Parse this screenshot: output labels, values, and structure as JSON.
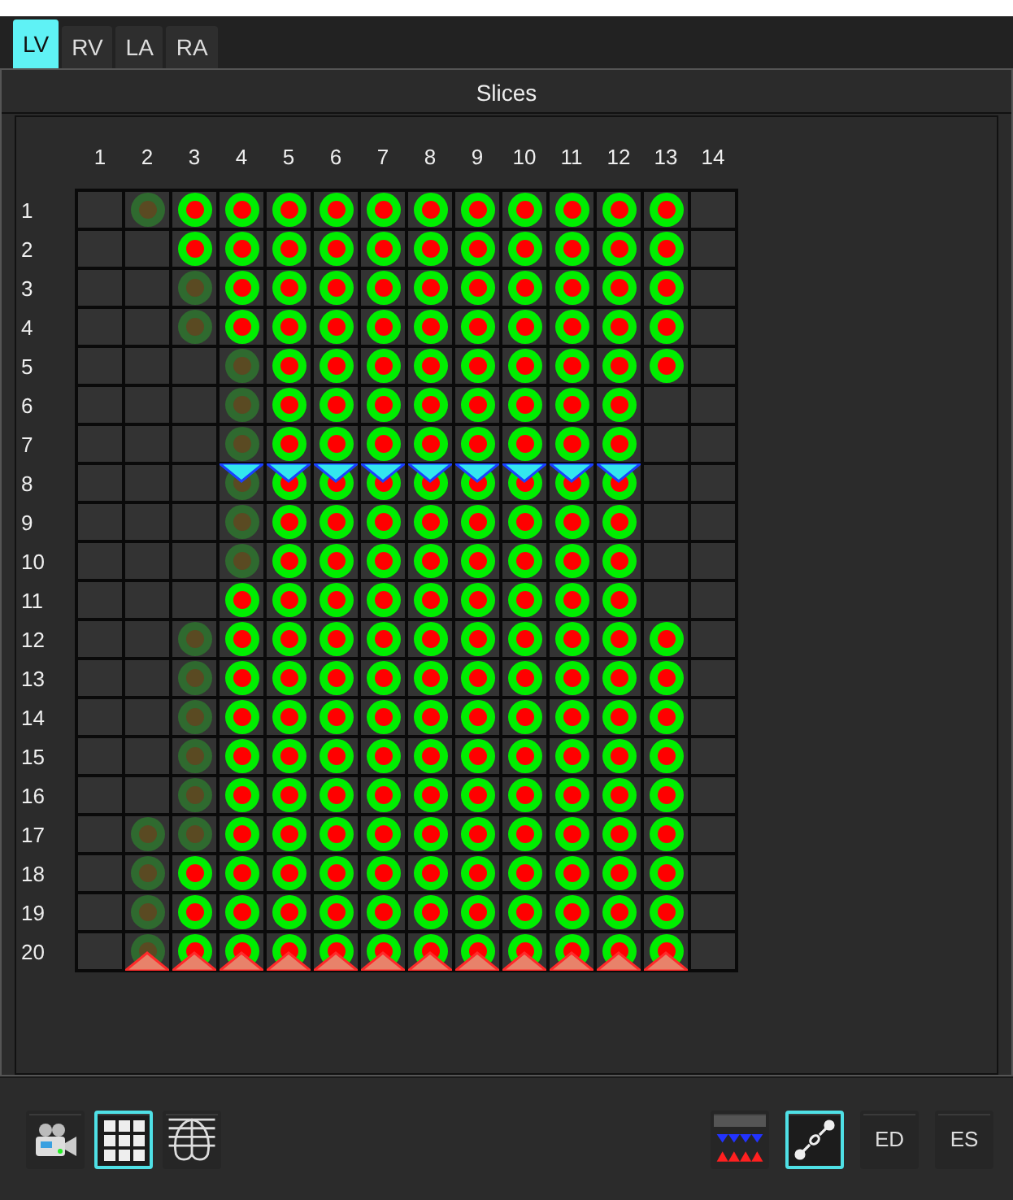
{
  "tabs": [
    {
      "label": "LV",
      "selected": true
    },
    {
      "label": "RV",
      "selected": false
    },
    {
      "label": "LA",
      "selected": false
    },
    {
      "label": "RA",
      "selected": false
    }
  ],
  "matrix": {
    "title": "Slices",
    "columns": [
      "1",
      "2",
      "3",
      "4",
      "5",
      "6",
      "7",
      "8",
      "9",
      "10",
      "11",
      "12",
      "13",
      "14"
    ],
    "rows": [
      {
        "label": "1",
        "ed_marker": false,
        "es_marker": false,
        "cells": [
          {
            "dot": false
          },
          {
            "dot": true,
            "dimmed": true
          },
          {
            "dot": true,
            "dimmed": false
          },
          {
            "dot": true,
            "dimmed": false
          },
          {
            "dot": true,
            "dimmed": false
          },
          {
            "dot": true,
            "dimmed": false
          },
          {
            "dot": true,
            "dimmed": false
          },
          {
            "dot": true,
            "dimmed": false
          },
          {
            "dot": true,
            "dimmed": false
          },
          {
            "dot": true,
            "dimmed": false
          },
          {
            "dot": true,
            "dimmed": false
          },
          {
            "dot": true,
            "dimmed": false
          },
          {
            "dot": true,
            "dimmed": false
          },
          {
            "dot": false
          }
        ]
      },
      {
        "label": "2",
        "ed_marker": false,
        "es_marker": false,
        "cells": [
          {
            "dot": false
          },
          {
            "dot": false
          },
          {
            "dot": true,
            "dimmed": false
          },
          {
            "dot": true,
            "dimmed": false
          },
          {
            "dot": true,
            "dimmed": false
          },
          {
            "dot": true,
            "dimmed": false
          },
          {
            "dot": true,
            "dimmed": false
          },
          {
            "dot": true,
            "dimmed": false
          },
          {
            "dot": true,
            "dimmed": false
          },
          {
            "dot": true,
            "dimmed": false
          },
          {
            "dot": true,
            "dimmed": false
          },
          {
            "dot": true,
            "dimmed": false
          },
          {
            "dot": true,
            "dimmed": false
          },
          {
            "dot": false
          }
        ]
      },
      {
        "label": "3",
        "ed_marker": false,
        "es_marker": false,
        "cells": [
          {
            "dot": false
          },
          {
            "dot": false
          },
          {
            "dot": true,
            "dimmed": true
          },
          {
            "dot": true,
            "dimmed": false
          },
          {
            "dot": true,
            "dimmed": false
          },
          {
            "dot": true,
            "dimmed": false
          },
          {
            "dot": true,
            "dimmed": false
          },
          {
            "dot": true,
            "dimmed": false
          },
          {
            "dot": true,
            "dimmed": false
          },
          {
            "dot": true,
            "dimmed": false
          },
          {
            "dot": true,
            "dimmed": false
          },
          {
            "dot": true,
            "dimmed": false
          },
          {
            "dot": true,
            "dimmed": false
          },
          {
            "dot": false
          }
        ]
      },
      {
        "label": "4",
        "ed_marker": false,
        "es_marker": false,
        "cells": [
          {
            "dot": false
          },
          {
            "dot": false
          },
          {
            "dot": true,
            "dimmed": true
          },
          {
            "dot": true,
            "dimmed": false
          },
          {
            "dot": true,
            "dimmed": false
          },
          {
            "dot": true,
            "dimmed": false
          },
          {
            "dot": true,
            "dimmed": false
          },
          {
            "dot": true,
            "dimmed": false
          },
          {
            "dot": true,
            "dimmed": false
          },
          {
            "dot": true,
            "dimmed": false
          },
          {
            "dot": true,
            "dimmed": false
          },
          {
            "dot": true,
            "dimmed": false
          },
          {
            "dot": true,
            "dimmed": false
          },
          {
            "dot": false
          }
        ]
      },
      {
        "label": "5",
        "ed_marker": false,
        "es_marker": false,
        "cells": [
          {
            "dot": false
          },
          {
            "dot": false
          },
          {
            "dot": false
          },
          {
            "dot": true,
            "dimmed": true
          },
          {
            "dot": true,
            "dimmed": false
          },
          {
            "dot": true,
            "dimmed": false
          },
          {
            "dot": true,
            "dimmed": false
          },
          {
            "dot": true,
            "dimmed": false
          },
          {
            "dot": true,
            "dimmed": false
          },
          {
            "dot": true,
            "dimmed": false
          },
          {
            "dot": true,
            "dimmed": false
          },
          {
            "dot": true,
            "dimmed": false
          },
          {
            "dot": true,
            "dimmed": false
          },
          {
            "dot": false
          }
        ]
      },
      {
        "label": "6",
        "ed_marker": false,
        "es_marker": false,
        "cells": [
          {
            "dot": false
          },
          {
            "dot": false
          },
          {
            "dot": false
          },
          {
            "dot": true,
            "dimmed": true
          },
          {
            "dot": true,
            "dimmed": false
          },
          {
            "dot": true,
            "dimmed": false
          },
          {
            "dot": true,
            "dimmed": false
          },
          {
            "dot": true,
            "dimmed": false
          },
          {
            "dot": true,
            "dimmed": false
          },
          {
            "dot": true,
            "dimmed": false
          },
          {
            "dot": true,
            "dimmed": false
          },
          {
            "dot": true,
            "dimmed": false
          },
          {
            "dot": false
          },
          {
            "dot": false
          }
        ]
      },
      {
        "label": "7",
        "ed_marker": false,
        "es_marker": false,
        "cells": [
          {
            "dot": false
          },
          {
            "dot": false
          },
          {
            "dot": false
          },
          {
            "dot": true,
            "dimmed": true
          },
          {
            "dot": true,
            "dimmed": false
          },
          {
            "dot": true,
            "dimmed": false
          },
          {
            "dot": true,
            "dimmed": false
          },
          {
            "dot": true,
            "dimmed": false
          },
          {
            "dot": true,
            "dimmed": false
          },
          {
            "dot": true,
            "dimmed": false
          },
          {
            "dot": true,
            "dimmed": false
          },
          {
            "dot": true,
            "dimmed": false
          },
          {
            "dot": false
          },
          {
            "dot": false
          }
        ]
      },
      {
        "label": "8",
        "ed_marker": true,
        "es_marker": false,
        "cells": [
          {
            "dot": false
          },
          {
            "dot": false
          },
          {
            "dot": false
          },
          {
            "dot": true,
            "dimmed": true
          },
          {
            "dot": true,
            "dimmed": false
          },
          {
            "dot": true,
            "dimmed": false
          },
          {
            "dot": true,
            "dimmed": false
          },
          {
            "dot": true,
            "dimmed": false
          },
          {
            "dot": true,
            "dimmed": false
          },
          {
            "dot": true,
            "dimmed": false
          },
          {
            "dot": true,
            "dimmed": false
          },
          {
            "dot": true,
            "dimmed": false
          },
          {
            "dot": false
          },
          {
            "dot": false
          }
        ]
      },
      {
        "label": "9",
        "ed_marker": false,
        "es_marker": false,
        "cells": [
          {
            "dot": false
          },
          {
            "dot": false
          },
          {
            "dot": false
          },
          {
            "dot": true,
            "dimmed": true
          },
          {
            "dot": true,
            "dimmed": false
          },
          {
            "dot": true,
            "dimmed": false
          },
          {
            "dot": true,
            "dimmed": false
          },
          {
            "dot": true,
            "dimmed": false
          },
          {
            "dot": true,
            "dimmed": false
          },
          {
            "dot": true,
            "dimmed": false
          },
          {
            "dot": true,
            "dimmed": false
          },
          {
            "dot": true,
            "dimmed": false
          },
          {
            "dot": false
          },
          {
            "dot": false
          }
        ]
      },
      {
        "label": "10",
        "ed_marker": false,
        "es_marker": false,
        "cells": [
          {
            "dot": false
          },
          {
            "dot": false
          },
          {
            "dot": false
          },
          {
            "dot": true,
            "dimmed": true
          },
          {
            "dot": true,
            "dimmed": false
          },
          {
            "dot": true,
            "dimmed": false
          },
          {
            "dot": true,
            "dimmed": false
          },
          {
            "dot": true,
            "dimmed": false
          },
          {
            "dot": true,
            "dimmed": false
          },
          {
            "dot": true,
            "dimmed": false
          },
          {
            "dot": true,
            "dimmed": false
          },
          {
            "dot": true,
            "dimmed": false
          },
          {
            "dot": false
          },
          {
            "dot": false
          }
        ]
      },
      {
        "label": "11",
        "ed_marker": false,
        "es_marker": false,
        "cells": [
          {
            "dot": false
          },
          {
            "dot": false
          },
          {
            "dot": false
          },
          {
            "dot": true,
            "dimmed": false
          },
          {
            "dot": true,
            "dimmed": false
          },
          {
            "dot": true,
            "dimmed": false
          },
          {
            "dot": true,
            "dimmed": false
          },
          {
            "dot": true,
            "dimmed": false
          },
          {
            "dot": true,
            "dimmed": false
          },
          {
            "dot": true,
            "dimmed": false
          },
          {
            "dot": true,
            "dimmed": false
          },
          {
            "dot": true,
            "dimmed": false
          },
          {
            "dot": false
          },
          {
            "dot": false
          }
        ]
      },
      {
        "label": "12",
        "ed_marker": false,
        "es_marker": false,
        "cells": [
          {
            "dot": false
          },
          {
            "dot": false
          },
          {
            "dot": true,
            "dimmed": true
          },
          {
            "dot": true,
            "dimmed": false
          },
          {
            "dot": true,
            "dimmed": false
          },
          {
            "dot": true,
            "dimmed": false
          },
          {
            "dot": true,
            "dimmed": false
          },
          {
            "dot": true,
            "dimmed": false
          },
          {
            "dot": true,
            "dimmed": false
          },
          {
            "dot": true,
            "dimmed": false
          },
          {
            "dot": true,
            "dimmed": false
          },
          {
            "dot": true,
            "dimmed": false
          },
          {
            "dot": true,
            "dimmed": false
          },
          {
            "dot": false
          }
        ]
      },
      {
        "label": "13",
        "ed_marker": false,
        "es_marker": false,
        "cells": [
          {
            "dot": false
          },
          {
            "dot": false
          },
          {
            "dot": true,
            "dimmed": true
          },
          {
            "dot": true,
            "dimmed": false
          },
          {
            "dot": true,
            "dimmed": false
          },
          {
            "dot": true,
            "dimmed": false
          },
          {
            "dot": true,
            "dimmed": false
          },
          {
            "dot": true,
            "dimmed": false
          },
          {
            "dot": true,
            "dimmed": false
          },
          {
            "dot": true,
            "dimmed": false
          },
          {
            "dot": true,
            "dimmed": false
          },
          {
            "dot": true,
            "dimmed": false
          },
          {
            "dot": true,
            "dimmed": false
          },
          {
            "dot": false
          }
        ]
      },
      {
        "label": "14",
        "ed_marker": false,
        "es_marker": false,
        "cells": [
          {
            "dot": false
          },
          {
            "dot": false
          },
          {
            "dot": true,
            "dimmed": true
          },
          {
            "dot": true,
            "dimmed": false
          },
          {
            "dot": true,
            "dimmed": false
          },
          {
            "dot": true,
            "dimmed": false
          },
          {
            "dot": true,
            "dimmed": false
          },
          {
            "dot": true,
            "dimmed": false
          },
          {
            "dot": true,
            "dimmed": false
          },
          {
            "dot": true,
            "dimmed": false
          },
          {
            "dot": true,
            "dimmed": false
          },
          {
            "dot": true,
            "dimmed": false
          },
          {
            "dot": true,
            "dimmed": false
          },
          {
            "dot": false
          }
        ]
      },
      {
        "label": "15",
        "ed_marker": false,
        "es_marker": false,
        "cells": [
          {
            "dot": false
          },
          {
            "dot": false
          },
          {
            "dot": true,
            "dimmed": true
          },
          {
            "dot": true,
            "dimmed": false
          },
          {
            "dot": true,
            "dimmed": false
          },
          {
            "dot": true,
            "dimmed": false
          },
          {
            "dot": true,
            "dimmed": false
          },
          {
            "dot": true,
            "dimmed": false
          },
          {
            "dot": true,
            "dimmed": false
          },
          {
            "dot": true,
            "dimmed": false
          },
          {
            "dot": true,
            "dimmed": false
          },
          {
            "dot": true,
            "dimmed": false
          },
          {
            "dot": true,
            "dimmed": false
          },
          {
            "dot": false
          }
        ]
      },
      {
        "label": "16",
        "ed_marker": false,
        "es_marker": false,
        "cells": [
          {
            "dot": false
          },
          {
            "dot": false
          },
          {
            "dot": true,
            "dimmed": true
          },
          {
            "dot": true,
            "dimmed": false
          },
          {
            "dot": true,
            "dimmed": false
          },
          {
            "dot": true,
            "dimmed": false
          },
          {
            "dot": true,
            "dimmed": false
          },
          {
            "dot": true,
            "dimmed": false
          },
          {
            "dot": true,
            "dimmed": false
          },
          {
            "dot": true,
            "dimmed": false
          },
          {
            "dot": true,
            "dimmed": false
          },
          {
            "dot": true,
            "dimmed": false
          },
          {
            "dot": true,
            "dimmed": false
          },
          {
            "dot": false
          }
        ]
      },
      {
        "label": "17",
        "ed_marker": false,
        "es_marker": false,
        "cells": [
          {
            "dot": false
          },
          {
            "dot": true,
            "dimmed": true
          },
          {
            "dot": true,
            "dimmed": true
          },
          {
            "dot": true,
            "dimmed": false
          },
          {
            "dot": true,
            "dimmed": false
          },
          {
            "dot": true,
            "dimmed": false
          },
          {
            "dot": true,
            "dimmed": false
          },
          {
            "dot": true,
            "dimmed": false
          },
          {
            "dot": true,
            "dimmed": false
          },
          {
            "dot": true,
            "dimmed": false
          },
          {
            "dot": true,
            "dimmed": false
          },
          {
            "dot": true,
            "dimmed": false
          },
          {
            "dot": true,
            "dimmed": false
          },
          {
            "dot": false
          }
        ]
      },
      {
        "label": "18",
        "ed_marker": false,
        "es_marker": false,
        "cells": [
          {
            "dot": false
          },
          {
            "dot": true,
            "dimmed": true
          },
          {
            "dot": true,
            "dimmed": false
          },
          {
            "dot": true,
            "dimmed": false
          },
          {
            "dot": true,
            "dimmed": false
          },
          {
            "dot": true,
            "dimmed": false
          },
          {
            "dot": true,
            "dimmed": false
          },
          {
            "dot": true,
            "dimmed": false
          },
          {
            "dot": true,
            "dimmed": false
          },
          {
            "dot": true,
            "dimmed": false
          },
          {
            "dot": true,
            "dimmed": false
          },
          {
            "dot": true,
            "dimmed": false
          },
          {
            "dot": true,
            "dimmed": false
          },
          {
            "dot": false
          }
        ]
      },
      {
        "label": "19",
        "ed_marker": false,
        "es_marker": false,
        "cells": [
          {
            "dot": false
          },
          {
            "dot": true,
            "dimmed": true
          },
          {
            "dot": true,
            "dimmed": false
          },
          {
            "dot": true,
            "dimmed": false
          },
          {
            "dot": true,
            "dimmed": false
          },
          {
            "dot": true,
            "dimmed": false
          },
          {
            "dot": true,
            "dimmed": false
          },
          {
            "dot": true,
            "dimmed": false
          },
          {
            "dot": true,
            "dimmed": false
          },
          {
            "dot": true,
            "dimmed": false
          },
          {
            "dot": true,
            "dimmed": false
          },
          {
            "dot": true,
            "dimmed": false
          },
          {
            "dot": true,
            "dimmed": false
          },
          {
            "dot": false
          }
        ]
      },
      {
        "label": "20",
        "ed_marker": false,
        "es_marker": true,
        "cells": [
          {
            "dot": false
          },
          {
            "dot": true,
            "dimmed": true
          },
          {
            "dot": true,
            "dimmed": false
          },
          {
            "dot": true,
            "dimmed": false
          },
          {
            "dot": true,
            "dimmed": false
          },
          {
            "dot": true,
            "dimmed": false
          },
          {
            "dot": true,
            "dimmed": false
          },
          {
            "dot": true,
            "dimmed": false
          },
          {
            "dot": true,
            "dimmed": false
          },
          {
            "dot": true,
            "dimmed": false
          },
          {
            "dot": true,
            "dimmed": false
          },
          {
            "dot": true,
            "dimmed": false
          },
          {
            "dot": true,
            "dimmed": false
          },
          {
            "dot": false
          }
        ]
      }
    ]
  },
  "toolbar": {
    "left": [
      {
        "kind": "camera",
        "selected": false
      },
      {
        "kind": "grid",
        "selected": true
      },
      {
        "kind": "slices",
        "selected": false
      }
    ],
    "right": [
      {
        "kind": "markers",
        "selected": false
      },
      {
        "kind": "link",
        "selected": true
      },
      {
        "kind": "text",
        "label": "ED",
        "selected": false
      },
      {
        "kind": "text",
        "label": "ES",
        "selected": false
      }
    ]
  }
}
